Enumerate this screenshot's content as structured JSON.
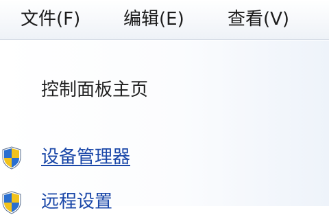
{
  "menubar": {
    "items": [
      {
        "label": "文件(F)"
      },
      {
        "label": "编辑(E)"
      },
      {
        "label": "查看(V)"
      }
    ]
  },
  "sidebar": {
    "home_label": "控制面板主页",
    "links": [
      {
        "label": "设备管理器",
        "icon": "uac-shield-icon",
        "underlined": true
      },
      {
        "label": "远程设置",
        "icon": "uac-shield-icon"
      }
    ]
  },
  "colors": {
    "link": "#1a47a8",
    "text": "#1c1c1c",
    "shield_blue": "#2a6fd0",
    "shield_yellow": "#f2c21b"
  }
}
